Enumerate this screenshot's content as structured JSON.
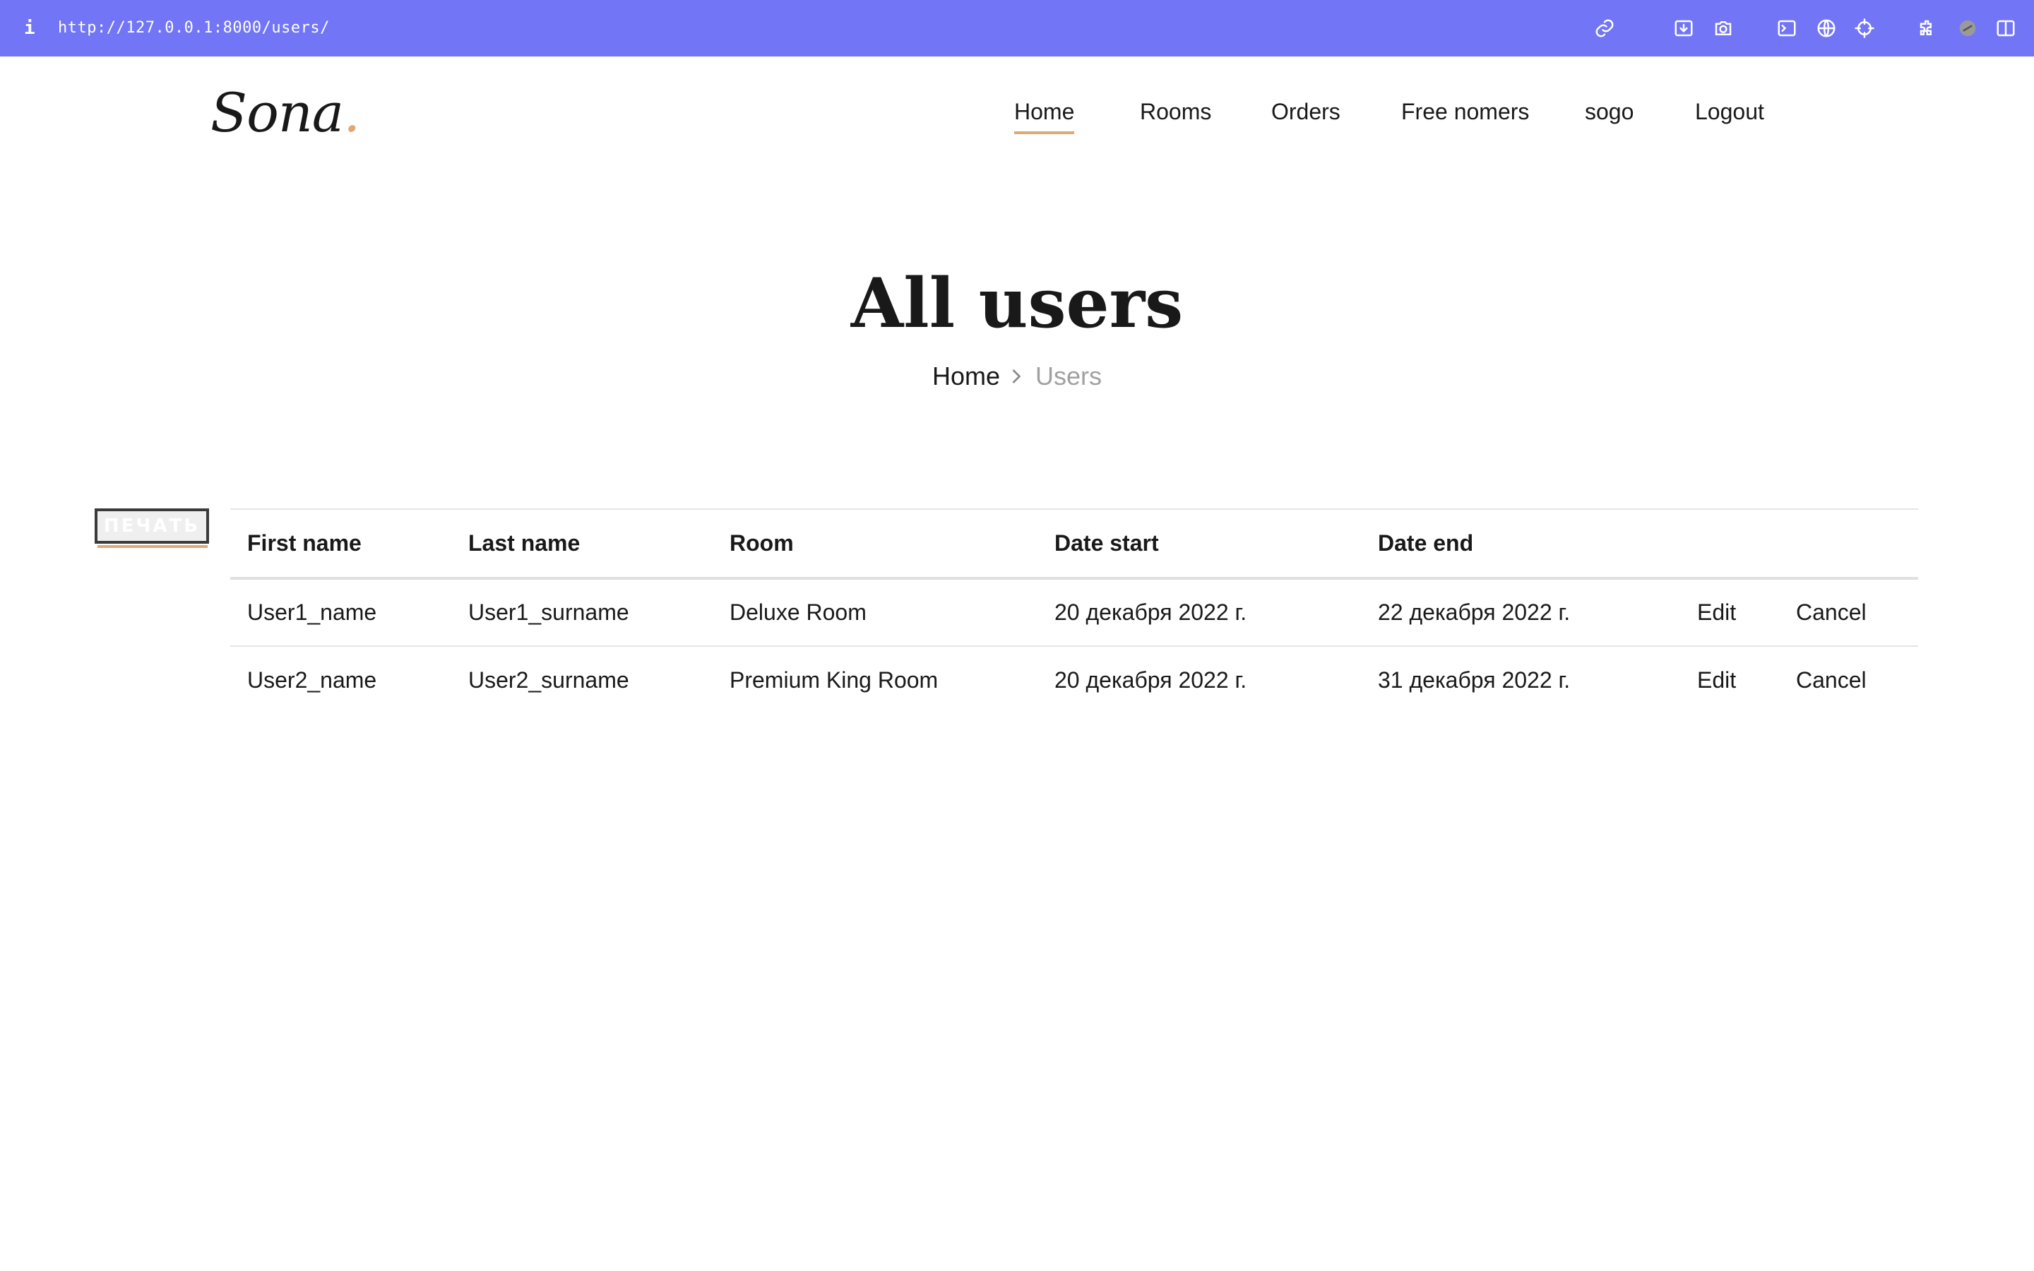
{
  "browser": {
    "info_glyph": "i",
    "url": "http://127.0.0.1:8000/users/",
    "toolbar_icons": [
      "link-icon",
      "download-icon",
      "camera-icon",
      "terminal-icon",
      "globe-icon",
      "crosshair-icon",
      "extensions-icon",
      "profile-icon",
      "sidebar-icon"
    ]
  },
  "header": {
    "logo_text": "Sona",
    "logo_dot": ".",
    "nav": [
      {
        "label": "Home",
        "active": true
      },
      {
        "label": "Rooms",
        "active": false
      },
      {
        "label": "Orders",
        "active": false
      },
      {
        "label": "Free nomers",
        "active": false
      },
      {
        "label": "sogo",
        "active": false
      },
      {
        "label": "Logout",
        "active": false
      }
    ]
  },
  "page": {
    "title": "All users",
    "breadcrumb": {
      "home": "Home",
      "current": "Users"
    }
  },
  "print_button": {
    "label": "ПЕЧАТЬ"
  },
  "table": {
    "headers": [
      "First name",
      "Last name",
      "Room",
      "Date start",
      "Date end",
      "",
      ""
    ],
    "rows": [
      {
        "first_name": "User1_name",
        "last_name": "User1_surname",
        "room": "Deluxe Room",
        "date_start": "20 декабря 2022 г.",
        "date_end": "22 декабря 2022 г.",
        "edit": "Edit",
        "cancel": "Cancel"
      },
      {
        "first_name": "User2_name",
        "last_name": "User2_surname",
        "room": "Premium King Room",
        "date_start": "20 декабря 2022 г.",
        "date_end": "31 декабря 2022 г.",
        "edit": "Edit",
        "cancel": "Cancel"
      }
    ]
  },
  "colors": {
    "chrome_bar": "#7275f5",
    "accent": "#dfa974",
    "text": "#19191a",
    "muted": "#a0a0a0"
  }
}
